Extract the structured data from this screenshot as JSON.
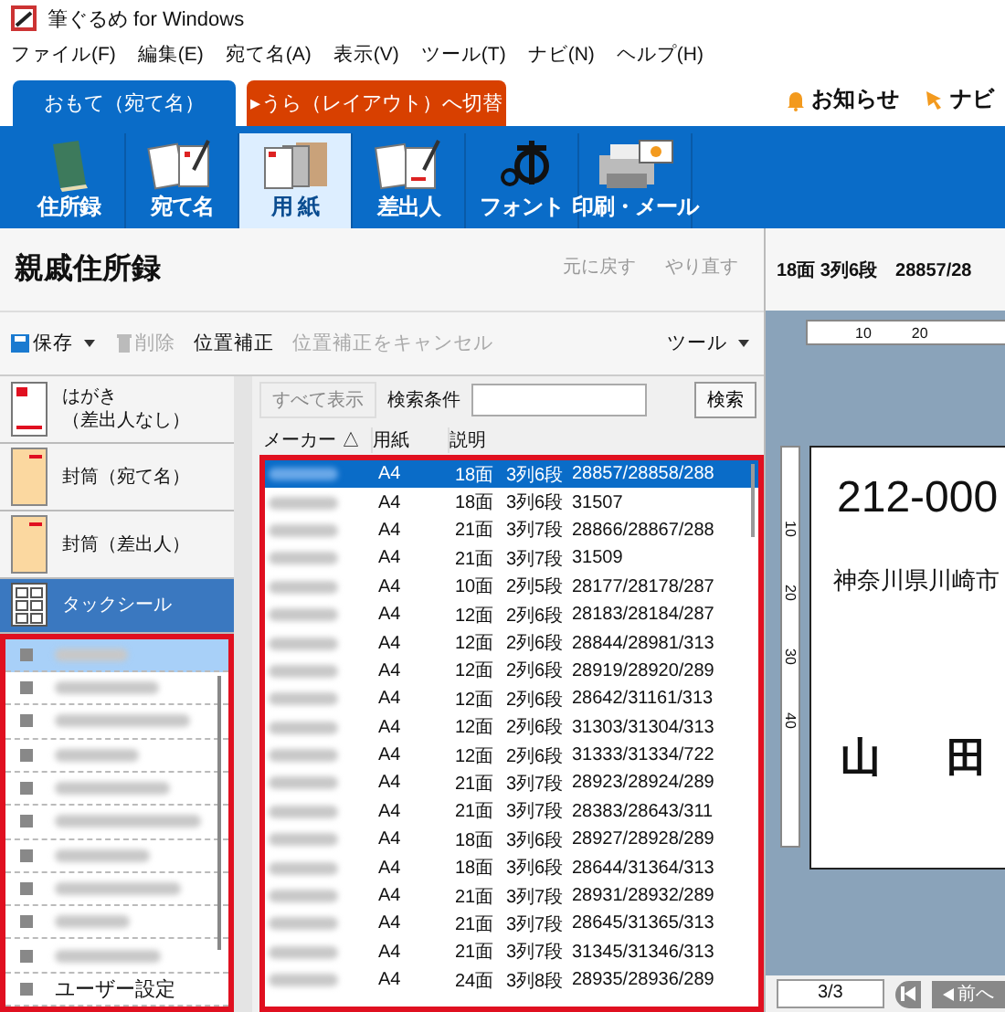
{
  "window": {
    "title": "筆ぐるめ for Windows"
  },
  "menu": [
    "ファイル(F)",
    "編集(E)",
    "宛て名(A)",
    "表示(V)",
    "ツール(T)",
    "ナビ(N)",
    "ヘルプ(H)"
  ],
  "face_tabs": [
    {
      "label": "おもて（宛て名）",
      "selected": true
    },
    {
      "label": "▸うら（レイアウト）へ切替",
      "selected": false
    }
  ],
  "header_links": [
    {
      "kind": "bell",
      "label": "お知らせ"
    },
    {
      "kind": "cursor",
      "label": "ナビ"
    }
  ],
  "ribbon": [
    {
      "kind": "book",
      "label": "住所録",
      "selected": false
    },
    {
      "kind": "cards",
      "label": "宛て名",
      "selected": false
    },
    {
      "kind": "paper",
      "label": "用 紙",
      "selected": true
    },
    {
      "kind": "sender",
      "label": "差出人",
      "selected": false
    },
    {
      "kind": "font",
      "label": "フォント",
      "selected": false
    },
    {
      "kind": "printer",
      "label": "印刷・メール",
      "selected": false
    }
  ],
  "address_book": {
    "title": "親戚住所録"
  },
  "history_buttons": [
    {
      "label": "元に戻す",
      "disabled": true
    },
    {
      "label": "やり直す",
      "disabled": true
    }
  ],
  "toolbar": [
    {
      "kind": "save",
      "label": "保存",
      "disabled": false,
      "dropdown": true
    },
    {
      "kind": "trash",
      "label": "削除",
      "disabled": true,
      "dropdown": false
    },
    {
      "kind": "plain",
      "label": "位置補正",
      "disabled": false,
      "dropdown": false
    },
    {
      "kind": "plain",
      "label": "位置補正をキャンセル",
      "disabled": true,
      "dropdown": false
    },
    {
      "kind": "tools",
      "label": "ツール",
      "disabled": false,
      "dropdown": true
    }
  ],
  "categories": [
    {
      "kind": "postcard",
      "lines": [
        "はがき",
        "（差出人なし）"
      ],
      "selected": false
    },
    {
      "kind": "envelope",
      "lines": [
        "封筒（宛て名）"
      ],
      "selected": false
    },
    {
      "kind": "envelope",
      "lines": [
        "封筒（差出人）"
      ],
      "selected": false
    },
    {
      "kind": "labels",
      "lines": [
        "タックシール"
      ],
      "selected": true
    }
  ],
  "makers": [
    {
      "selected": true
    },
    {
      "selected": false
    },
    {
      "selected": false
    },
    {
      "selected": false
    },
    {
      "selected": false
    },
    {
      "selected": false
    },
    {
      "selected": false
    },
    {
      "selected": false
    },
    {
      "selected": false
    },
    {
      "selected": false
    },
    {
      "label": "ユーザー設定",
      "selected": false
    }
  ],
  "search": {
    "show_all": "すべて表示",
    "label": "検索条件",
    "button": "検索"
  },
  "table": {
    "columns": [
      "メーカー △",
      "用紙",
      "説明"
    ],
    "rows": [
      {
        "paper": "A4",
        "faces": "18面",
        "layout": "3列6段",
        "codes": "28857/28858/288",
        "selected": true
      },
      {
        "paper": "A4",
        "faces": "18面",
        "layout": "3列6段",
        "codes": "31507",
        "selected": false
      },
      {
        "paper": "A4",
        "faces": "21面",
        "layout": "3列7段",
        "codes": "28866/28867/288",
        "selected": false
      },
      {
        "paper": "A4",
        "faces": "21面",
        "layout": "3列7段",
        "codes": "31509",
        "selected": false
      },
      {
        "paper": "A4",
        "faces": "10面",
        "layout": "2列5段",
        "codes": "28177/28178/287",
        "selected": false
      },
      {
        "paper": "A4",
        "faces": "12面",
        "layout": "2列6段",
        "codes": "28183/28184/287",
        "selected": false
      },
      {
        "paper": "A4",
        "faces": "12面",
        "layout": "2列6段",
        "codes": "28844/28981/313",
        "selected": false
      },
      {
        "paper": "A4",
        "faces": "12面",
        "layout": "2列6段",
        "codes": "28919/28920/289",
        "selected": false
      },
      {
        "paper": "A4",
        "faces": "12面",
        "layout": "2列6段",
        "codes": "28642/31161/313",
        "selected": false
      },
      {
        "paper": "A4",
        "faces": "12面",
        "layout": "2列6段",
        "codes": "31303/31304/313",
        "selected": false
      },
      {
        "paper": "A4",
        "faces": "12面",
        "layout": "2列6段",
        "codes": "31333/31334/722",
        "selected": false
      },
      {
        "paper": "A4",
        "faces": "21面",
        "layout": "3列7段",
        "codes": "28923/28924/289",
        "selected": false
      },
      {
        "paper": "A4",
        "faces": "21面",
        "layout": "3列7段",
        "codes": "28383/28643/311",
        "selected": false
      },
      {
        "paper": "A4",
        "faces": "18面",
        "layout": "3列6段",
        "codes": "28927/28928/289",
        "selected": false
      },
      {
        "paper": "A4",
        "faces": "18面",
        "layout": "3列6段",
        "codes": "28644/31364/313",
        "selected": false
      },
      {
        "paper": "A4",
        "faces": "21面",
        "layout": "3列7段",
        "codes": "28931/28932/289",
        "selected": false
      },
      {
        "paper": "A4",
        "faces": "21面",
        "layout": "3列7段",
        "codes": "28645/31365/313",
        "selected": false
      },
      {
        "paper": "A4",
        "faces": "21面",
        "layout": "3列7段",
        "codes": "31345/31346/313",
        "selected": false
      },
      {
        "paper": "A4",
        "faces": "24面",
        "layout": "3列8段",
        "codes": "28935/28936/289",
        "selected": false
      }
    ]
  },
  "preview": {
    "header": "18面 3列6段　28857/28",
    "top_ruler": [
      "10",
      "20"
    ],
    "left_ruler": [
      "10",
      "20",
      "30",
      "40"
    ],
    "label": {
      "postal": "212-000",
      "address": "神奈川県川崎市",
      "name": [
        "山",
        "田"
      ]
    },
    "page": "3/3",
    "prev_button": "前へ"
  }
}
